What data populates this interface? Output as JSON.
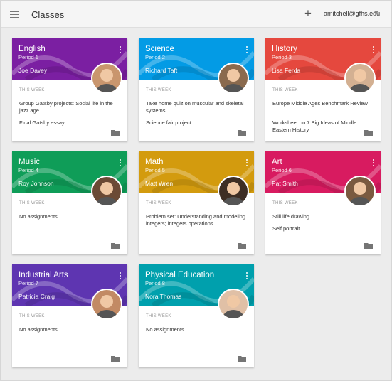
{
  "header": {
    "title": "Classes",
    "add_icon": "+",
    "account": "amitchell@gfhs.edu"
  },
  "week_label": "THIS WEEK",
  "classes": [
    {
      "name": "English",
      "period": "Period 1",
      "teacher": "Joe Davey",
      "color": "#7b1fa2",
      "assignments": [
        "Group Gatsby projects: Social life in the jazz age",
        "Final Gatsby essay"
      ]
    },
    {
      "name": "Science",
      "period": "Period 2",
      "teacher": "Richard Taft",
      "color": "#039be5",
      "assignments": [
        "Take home quiz on muscular and skeletal systems",
        "Science fair project"
      ]
    },
    {
      "name": "History",
      "period": "Period 3",
      "teacher": "Lisa Ferda",
      "color": "#e5483e",
      "assignments": [
        "Europe Middle Ages Benchmark Review",
        "Worksheet on 7 Big Ideas of Middle Eastern History"
      ]
    },
    {
      "name": "Music",
      "period": "Period 4",
      "teacher": "Roy Johnson",
      "color": "#0f9d58",
      "assignments": [
        "No assignments"
      ]
    },
    {
      "name": "Math",
      "period": "Period 5",
      "teacher": "Matt Wren",
      "color": "#d39b0e",
      "assignments": [
        "Problem set: Understanding and modeling integers; integers operations"
      ]
    },
    {
      "name": "Art",
      "period": "Period 6",
      "teacher": "Pat Smith",
      "color": "#d81b60",
      "assignments": [
        "Still life drawing",
        "Self portrait"
      ]
    },
    {
      "name": "Industrial Arts",
      "period": "Period 7",
      "teacher": "Patricia Craig",
      "color": "#5e35b1",
      "assignments": [
        "No assignments"
      ]
    },
    {
      "name": "Physical Education",
      "period": "Period 8",
      "teacher": "Nora Thomas",
      "color": "#00a0ad",
      "assignments": [
        "No assignments"
      ]
    }
  ]
}
